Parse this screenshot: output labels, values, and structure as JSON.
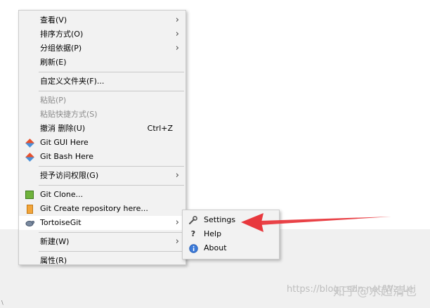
{
  "main_menu": {
    "view": "查看(V)",
    "sort_by": "排序方式(O)",
    "group_by": "分组依据(P)",
    "refresh": "刷新(E)",
    "customize_folder": "自定义文件夹(F)...",
    "paste": "粘贴(P)",
    "paste_shortcut": "粘贴快捷方式(S)",
    "undo_delete": "撤消 删除(U)",
    "undo_shortcut": "Ctrl+Z",
    "git_gui_here": "Git GUI Here",
    "git_bash_here": "Git Bash Here",
    "grant_access": "授予访问权限(G)",
    "git_clone": "Git Clone...",
    "git_create_repo": "Git Create repository here...",
    "tortoisegit": "TortoiseGit",
    "new": "新建(W)",
    "properties": "属性(R)"
  },
  "submenu": {
    "settings": "Settings",
    "help": "Help",
    "about": "About"
  },
  "icons": {
    "submenu_arrow": "chevron-right-icon",
    "git_gui": "git-diamond-icon",
    "git_bash": "git-diamond-icon",
    "git_clone": "git-clone-icon",
    "git_create_repo": "git-repo-icon",
    "tortoisegit": "tortoise-icon",
    "settings": "wrench-icon",
    "help": "question-mark-icon",
    "about": "info-icon"
  },
  "annotation_color": "#e8383d",
  "watermark": {
    "site": "知乎",
    "author": "@水超清也",
    "url": "https://blog.csdn.net/Wz_Lei"
  }
}
